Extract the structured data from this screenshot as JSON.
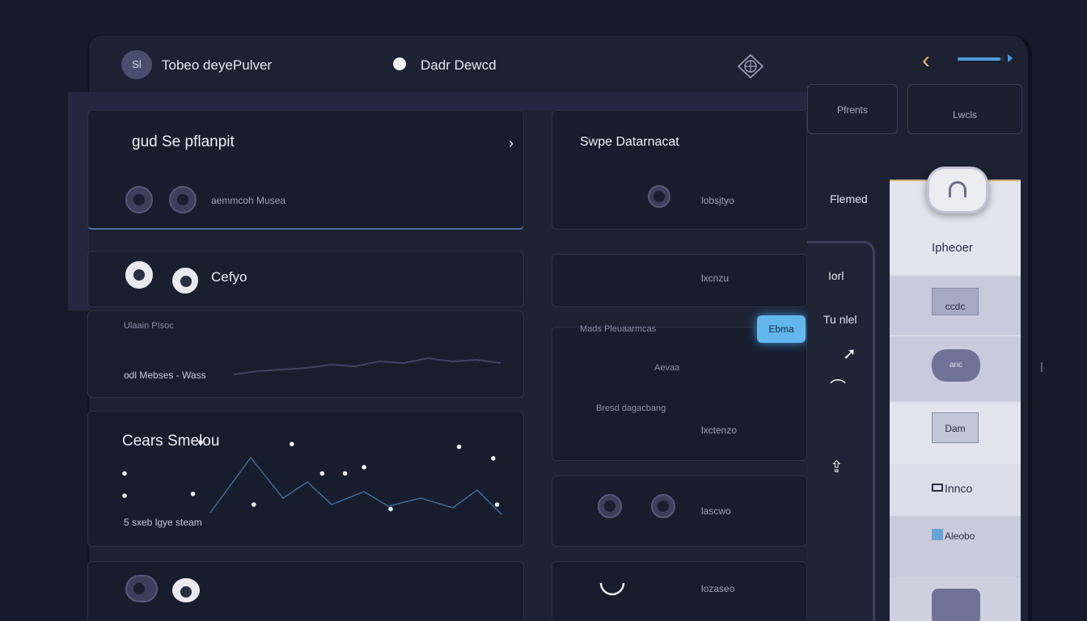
{
  "header": {
    "avatar_label": "Sl",
    "app_title": "Tobeo deyePulver",
    "dashboard_title": "Dadr Dewcd",
    "progress": 0.92
  },
  "top_buttons": [
    {
      "label": "Pfrents"
    },
    {
      "label": "Lwcls"
    }
  ],
  "left_cards": {
    "card1": {
      "title": "gud Se pflanpit",
      "caption": "aemmcoh Musea"
    },
    "card2": {
      "label": "Cefyo"
    },
    "card3": {
      "caption_top": "Ulaain PIsoc",
      "caption_bottom": "odl Mebses - Wass"
    },
    "chart_card": {
      "title": "Cears Smelou",
      "caption": "5 sxeb lgye steam"
    }
  },
  "mid_cards": {
    "card1": {
      "title": "Swpe Datarnacat",
      "value": "lobsjtyo"
    },
    "card2": {
      "value": "lxcnzu"
    },
    "card3": {
      "caption": "Mads Pleuaarmcas",
      "chip": "Ebma",
      "sub1": "Aevaa",
      "sub2": "Bresd dagacbang",
      "value": "lxctenzo"
    },
    "card4": {
      "value": "lascwo"
    },
    "card5": {
      "value": "lozaseo"
    }
  },
  "rail": {
    "label1": "Flemed",
    "label2": "Iorl",
    "label3": "Tu nlel"
  },
  "panel": {
    "title": "Ipheoer",
    "box1": "ccdc",
    "pill": "anc",
    "box2": "Dam",
    "item1": "Innco",
    "item2": "Aleobo"
  },
  "chart_data": {
    "type": "scatter",
    "series": [
      {
        "x": [
          0.0,
          0.0,
          0.18,
          0.2,
          0.34,
          0.44,
          0.52,
          0.58,
          0.63,
          0.7,
          0.88,
          0.97,
          0.98
        ],
        "y": [
          0.55,
          0.3,
          0.32,
          0.9,
          0.2,
          0.88,
          0.55,
          0.55,
          0.62,
          0.15,
          0.85,
          0.72,
          0.2
        ]
      }
    ]
  },
  "colors": {
    "accent": "#4e9bd6",
    "chip": "#63b7ec",
    "warm": "#e1b36a"
  }
}
